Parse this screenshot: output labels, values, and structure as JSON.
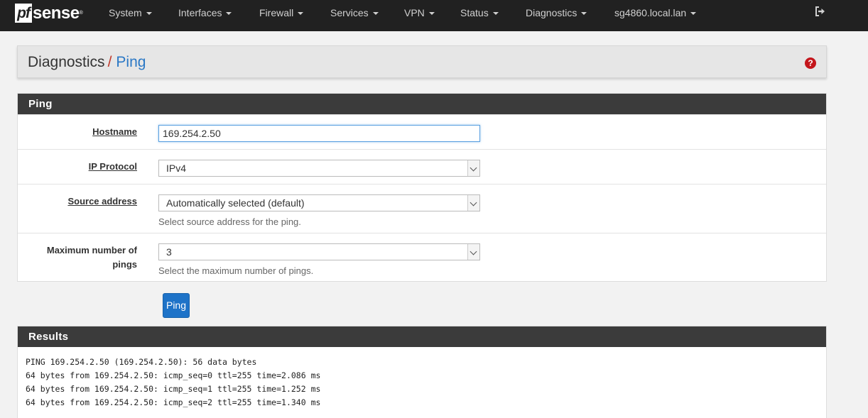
{
  "navbar": {
    "brand_mark": "pf",
    "brand_text": "sense",
    "brand_tm": "®",
    "menus": [
      "System",
      "Interfaces",
      "Firewall",
      "Services",
      "VPN",
      "Status",
      "Diagnostics",
      "sg4860.local.lan"
    ],
    "logout_icon": "logout-icon"
  },
  "breadcrumb": {
    "section": "Diagnostics",
    "separator": "/",
    "page": "Ping",
    "help_icon": "question-circle-icon"
  },
  "ping_panel": {
    "title": "Ping",
    "hostname": {
      "label": "Hostname",
      "value": "169.254.2.50"
    },
    "ip_protocol": {
      "label": "IP Protocol",
      "value": "IPv4"
    },
    "source_address": {
      "label": "Source address",
      "value": "Automatically selected (default)",
      "help": "Select source address for the ping."
    },
    "max_pings": {
      "label_line1": "Maximum number of",
      "label_line2": "pings",
      "value": "3",
      "help": "Select the maximum number of pings."
    }
  },
  "ping_button": {
    "label": "Ping"
  },
  "results_panel": {
    "title": "Results",
    "lines": [
      "PING 169.254.2.50 (169.254.2.50): 56 data bytes",
      "64 bytes from 169.254.2.50: icmp_seq=0 ttl=255 time=2.086 ms",
      "64 bytes from 169.254.2.50: icmp_seq=1 ttl=255 time=1.252 ms",
      "64 bytes from 169.254.2.50: icmp_seq=2 ttl=255 time=1.340 ms"
    ]
  },
  "colors": {
    "navbar_bg": "#212121",
    "panel_heading_bg": "#3b3b3b",
    "breadcrumb_current": "#2b78c5",
    "breadcrumb_separator": "#c0392b",
    "button_primary": "#1e73c8",
    "help_icon": "#c4161c"
  }
}
